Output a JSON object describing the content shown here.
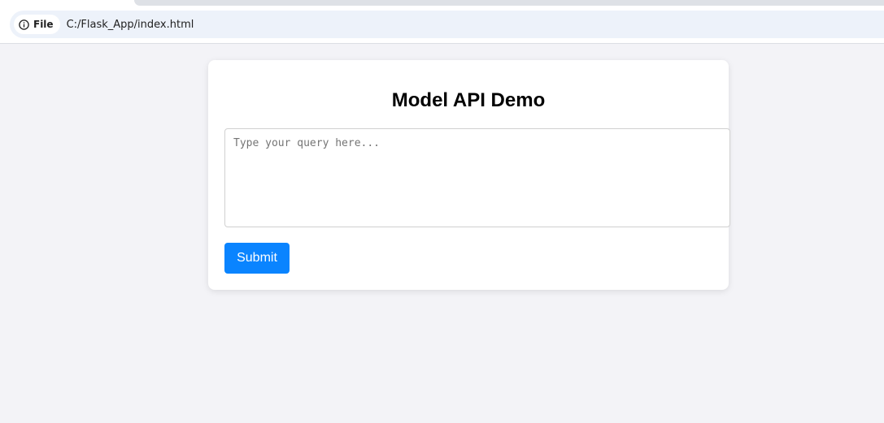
{
  "browser": {
    "site_chip_label": "File",
    "site_chip_icon": "info-icon",
    "url": "C:/Flask_App/index.html"
  },
  "page": {
    "title": "Model API Demo",
    "query": {
      "value": "",
      "placeholder": "Type your query here..."
    },
    "submit_label": "Submit"
  },
  "colors": {
    "accent": "#0a84ff",
    "page_background": "#f3f3f7",
    "omnibox_background": "#edf2fa"
  }
}
